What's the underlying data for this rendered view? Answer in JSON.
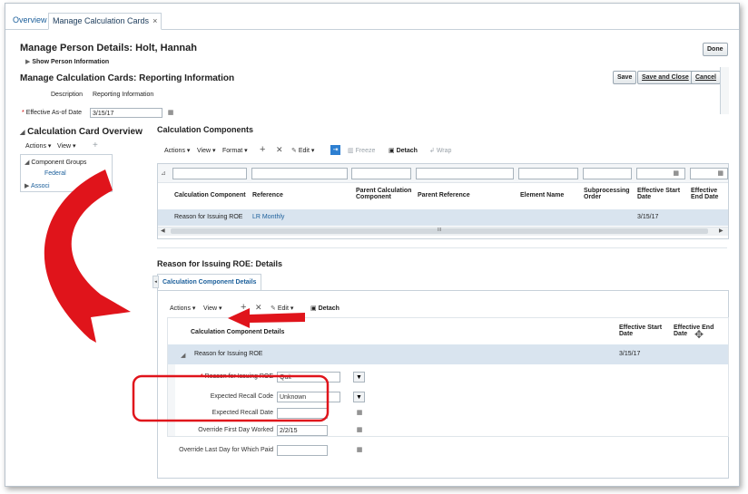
{
  "tabs": [
    {
      "label": "Overview"
    },
    {
      "label": "Manage Calculation Cards",
      "close": "×"
    }
  ],
  "header": {
    "title": "Manage Person Details: Holt, Hannah",
    "done_label": "Done",
    "show_person_info": "Show Person Information",
    "subtitle": "Manage Calculation Cards: Reporting Information",
    "save_label": "Save",
    "save_close_label": "Save and Close",
    "cancel_label": "Cancel"
  },
  "form": {
    "description_label": "Description",
    "description_value": "Reporting Information",
    "effective_date_label": "Effective As-of Date",
    "effective_date_value": "3/15/17"
  },
  "overview": {
    "title": "Calculation Card Overview",
    "actions_label": "Actions",
    "view_label": "View",
    "tree": [
      {
        "label": "Component Groups",
        "expanded": true
      },
      {
        "label": "Federal",
        "child": true
      },
      {
        "label": "Associ",
        "expanded": false
      }
    ]
  },
  "components": {
    "title": "Calculation Components",
    "toolbar": {
      "actions": "Actions",
      "view": "View",
      "format": "Format",
      "edit": "Edit",
      "freeze": "Freeze",
      "detach": "Detach",
      "wrap": "Wrap"
    },
    "columns": [
      "Calculation Component",
      "Reference",
      "Parent Calculation Component",
      "Parent Reference",
      "Element Name",
      "Subprocessing Order",
      "Effective Start Date",
      "Effective End Date"
    ],
    "rows": [
      {
        "component": "Reason for Issuing ROE",
        "reference": "LR Monthly",
        "start": "3/15/17"
      }
    ],
    "scroll_mark": "III"
  },
  "details": {
    "title": "Reason for Issuing ROE: Details",
    "tab_label": "Calculation Component Details",
    "toolbar": {
      "actions": "Actions",
      "view": "View",
      "edit": "Edit",
      "detach": "Detach"
    },
    "columns": {
      "name": "Calculation Component Details",
      "start": "Effective Start Date",
      "end": "Effective End Date"
    },
    "row": {
      "name": "Reason for Issuing ROE",
      "start": "3/15/17"
    },
    "fields": {
      "reason_label": "Reason for Issuing ROE",
      "reason_value": "Quit",
      "recall_code_label": "Expected Recall Code",
      "recall_code_value": "Unknown",
      "recall_date_label": "Expected Recall Date",
      "recall_date_value": "",
      "first_day_label": "Override First Day Worked",
      "first_day_value": "2/2/15",
      "last_day_label": "Override Last Day for Which Paid",
      "last_day_value": ""
    }
  },
  "colors": {
    "link": "#1a5e9a",
    "selected_row": "#d9e4ef",
    "annotation_red": "#e0141b"
  }
}
